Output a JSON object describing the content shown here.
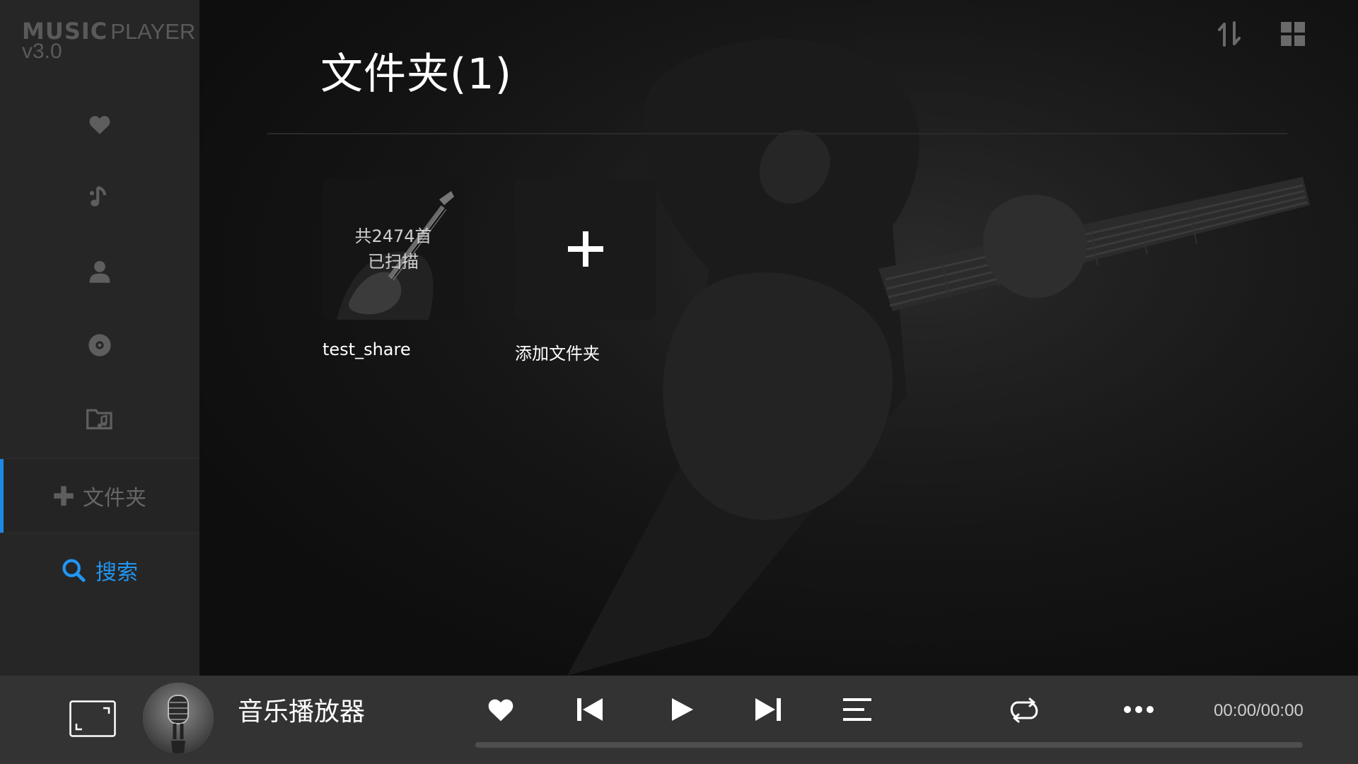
{
  "app": {
    "brand_main": "MUSIC",
    "brand_sub": "PLAYER",
    "version": "v3.0"
  },
  "sidebar": {
    "items": [
      {
        "id": "favorites",
        "icon": "heart-icon"
      },
      {
        "id": "songs",
        "icon": "music-note-icon"
      },
      {
        "id": "artists",
        "icon": "person-icon"
      },
      {
        "id": "albums",
        "icon": "disc-icon"
      },
      {
        "id": "folders",
        "icon": "music-folder-icon"
      }
    ],
    "add_folder_label": "文件夹",
    "search_label": "搜索",
    "active_accent": "#1e88e5",
    "search_color": "#2196f3"
  },
  "main": {
    "title": "文件夹(1)",
    "toolbar": {
      "sort_icon": "sort-icon",
      "grid_icon": "grid-view-icon"
    },
    "folders": [
      {
        "name": "test_share",
        "count_text": "共2474首",
        "status_text": "已扫描"
      }
    ],
    "add_folder_tile_label": "添加文件夹"
  },
  "player": {
    "track_title": "音乐播放器",
    "time": "00:00/00:00",
    "progress": 0
  }
}
